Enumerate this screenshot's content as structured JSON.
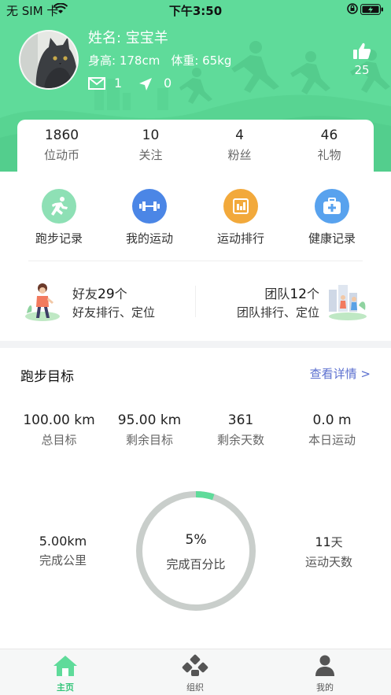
{
  "status_bar": {
    "carrier": "无 SIM 卡",
    "time": "下午3:50"
  },
  "profile": {
    "name": "姓名: 宝宝羊",
    "height": "身高: 178cm",
    "weight": "体重: 65kg",
    "messages": "1",
    "location": "0",
    "likes": "25"
  },
  "stats": [
    {
      "value": "1860",
      "label": "位动币"
    },
    {
      "value": "10",
      "label": "关注"
    },
    {
      "value": "4",
      "label": "粉丝"
    },
    {
      "value": "46",
      "label": "礼物"
    }
  ],
  "quick_actions": [
    {
      "label": "跑步记录",
      "icon": "running-icon",
      "color": "#7ddba8"
    },
    {
      "label": "我的运动",
      "icon": "dumbbell-icon",
      "color": "#4b86e6"
    },
    {
      "label": "运动排行",
      "icon": "ranking-icon",
      "color": "#f2a93b"
    },
    {
      "label": "健康记录",
      "icon": "medical-kit-icon",
      "color": "#58a2ee"
    }
  ],
  "friends": {
    "title": "好友",
    "count": "29",
    "unit": "个",
    "subtitle": "好友排行、定位"
  },
  "teams": {
    "title": "团队",
    "count": "12",
    "unit": "个",
    "subtitle": "团队排行、定位"
  },
  "goal": {
    "title": "跑步目标",
    "details_link": "查看详情 >",
    "metrics": [
      {
        "value": "100.00 km",
        "label": "总目标"
      },
      {
        "value": "95.00 km",
        "label": "剩余目标"
      },
      {
        "value": "361",
        "label": "剩余天数"
      },
      {
        "value": "0.0 m",
        "label": "本日运动"
      }
    ],
    "completed_km": "5.00km",
    "completed_label": "完成公里",
    "percent_text": "5%",
    "percent_value": 0.05,
    "percent_label": "完成百分比",
    "days_value": "11",
    "days_unit": "天",
    "days_label": "运动天数"
  },
  "tabs": [
    {
      "label": "主页",
      "icon": "home-icon",
      "active": true
    },
    {
      "label": "组织",
      "icon": "organization-icon",
      "active": false
    },
    {
      "label": "我的",
      "icon": "profile-icon",
      "active": false
    }
  ],
  "colors": {
    "brand_green": "#5fdb9a",
    "link_blue": "#5b6fcf",
    "ring_gray": "#c9cecb"
  }
}
